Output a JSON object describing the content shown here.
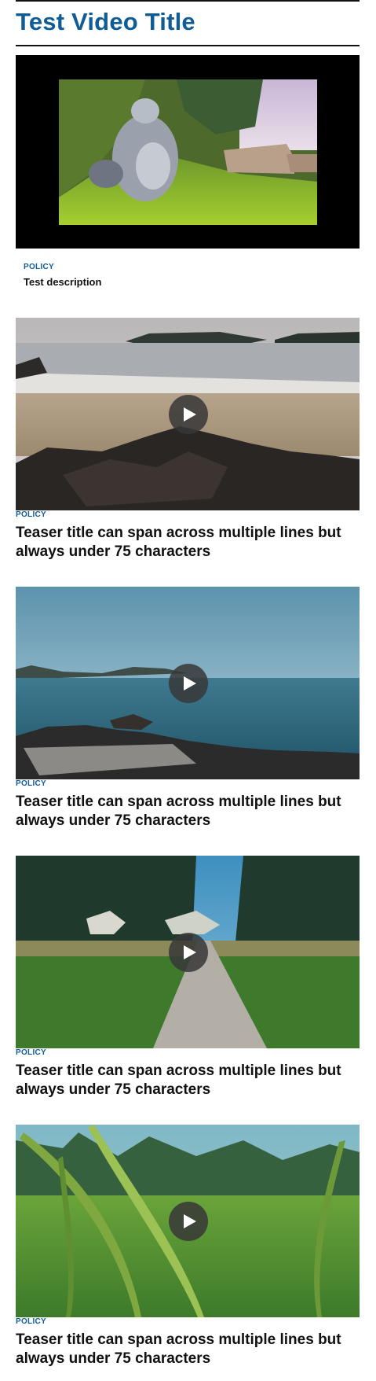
{
  "page": {
    "title": "Test Video Title"
  },
  "video": {
    "category": "POLICY",
    "description": "Test description"
  },
  "teasers": [
    {
      "category": "POLICY",
      "title": "Teaser title can span across multiple lines but always under 75 characters",
      "image": "beach-rocks-image"
    },
    {
      "category": "POLICY",
      "title": "Teaser title can span across multiple lines but always under 75 characters",
      "image": "lake-shore-image"
    },
    {
      "category": "POLICY",
      "title": "Teaser title can span across multiple lines but always under 75 characters",
      "image": "forest-path-image"
    },
    {
      "category": "POLICY",
      "title": "Teaser title can span across multiple lines but always under 75 characters",
      "image": "grass-meadow-image"
    }
  ],
  "colors": {
    "accent": "#0f5c96",
    "text": "#111111",
    "video_bg": "#000000"
  },
  "icons": {
    "play": "play-icon"
  }
}
